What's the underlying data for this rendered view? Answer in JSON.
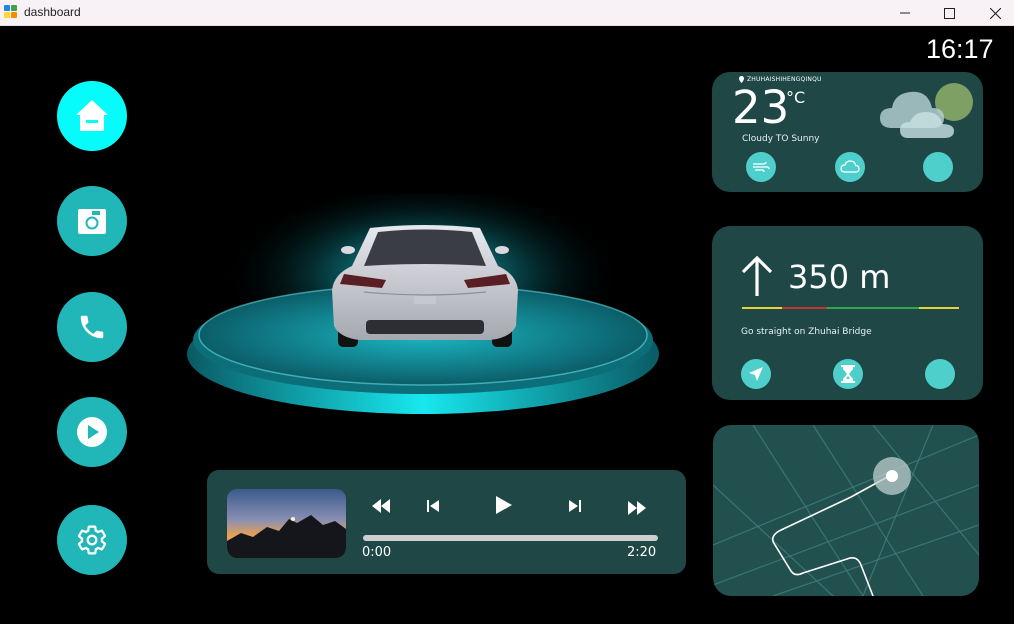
{
  "window": {
    "title": "dashboard",
    "icon_colors": [
      "#1e88e5",
      "#43a047",
      "#fdd835",
      "#fb8c00"
    ]
  },
  "clock": "16:17",
  "colors": {
    "accent": "#21b7b8",
    "accent_active": "#06fbfb",
    "card_bg": "#1e4746",
    "icon_circle": "#4fcfcb"
  },
  "sidebar": {
    "items": [
      {
        "name": "home",
        "icon": "home-icon",
        "active": true
      },
      {
        "name": "camera",
        "icon": "camera-icon",
        "active": false
      },
      {
        "name": "phone",
        "icon": "phone-icon",
        "active": false
      },
      {
        "name": "video",
        "icon": "play-circle-icon",
        "active": false
      },
      {
        "name": "settings",
        "icon": "gear-icon",
        "active": false
      }
    ]
  },
  "media": {
    "current_time": "0:00",
    "total_time": "2:20",
    "progress": 0,
    "controls": [
      "fast-rewind-icon",
      "skip-previous-icon",
      "play-icon",
      "skip-next-icon",
      "fast-forward-icon"
    ]
  },
  "weather": {
    "location": "ZHUHAISHIHENGQINQU",
    "temperature": "23",
    "unit": "°C",
    "condition": "Cloudy TO Sunny",
    "icons": [
      "wind-icon",
      "cloud-icon",
      "circle-icon"
    ]
  },
  "navigation": {
    "direction": "arrow-up-icon",
    "distance": "350 m",
    "instruction": "Go straight on Zhuhai Bridge",
    "lane_colors": [
      "#e8d23a",
      "#c0392b",
      "#2ea84a",
      "#e8d23a"
    ],
    "icons": [
      "send-icon",
      "hourglass-icon",
      "circle-icon"
    ]
  },
  "map": {
    "icon": "location-marker-icon"
  }
}
